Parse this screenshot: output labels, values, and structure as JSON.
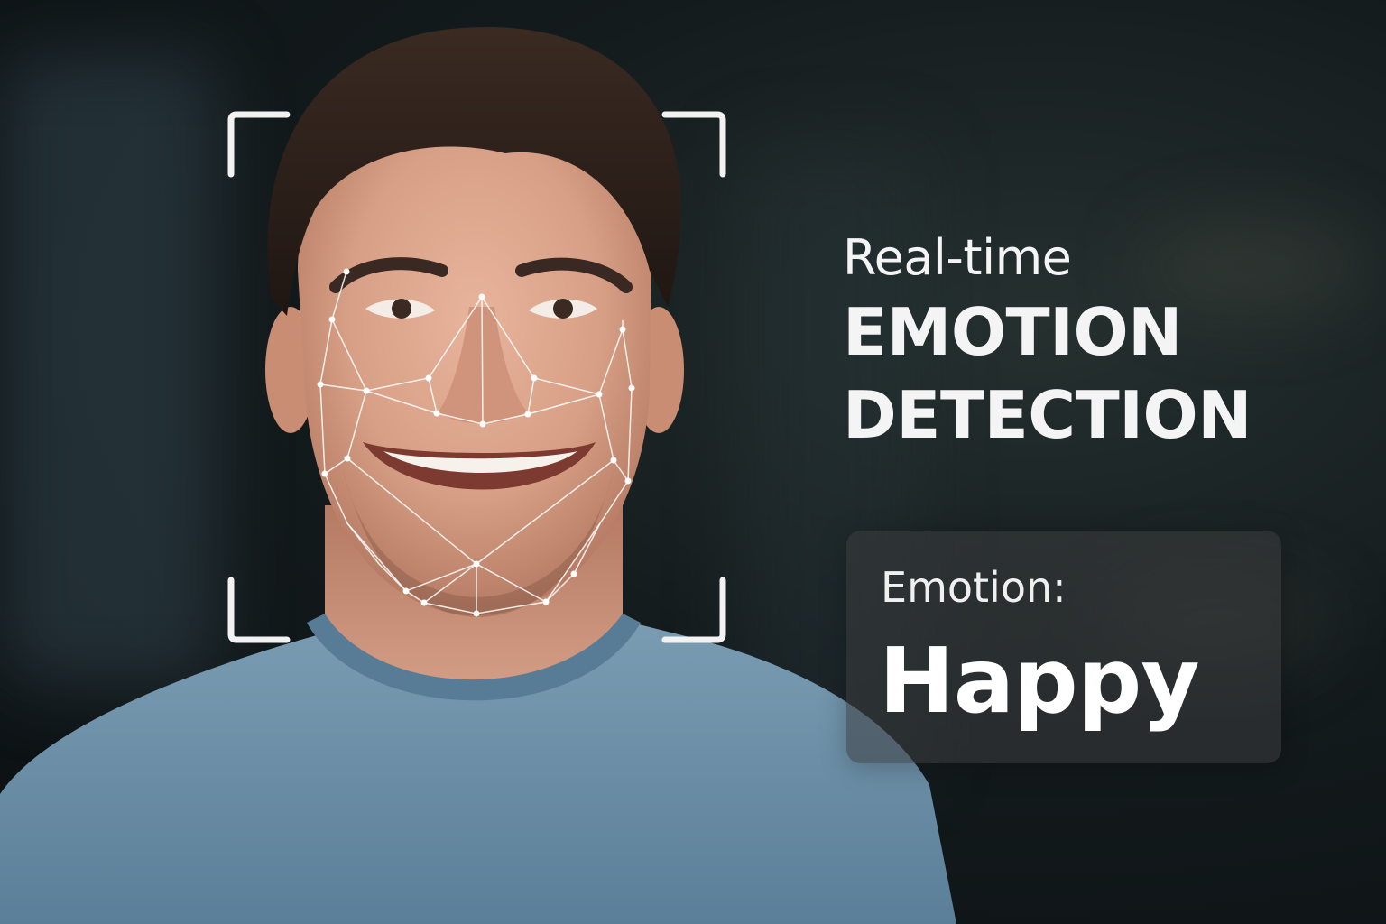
{
  "headline": {
    "line1": "Real-time",
    "line2": "EMOTION",
    "line3": "DETECTION"
  },
  "emotion_card": {
    "label": "Emotion:",
    "value": "Happy"
  },
  "colors": {
    "background": "#141b1d",
    "shirt": "#6a8fa8",
    "text": "#f4f4f4",
    "card": "#3a3c3e"
  },
  "icons": [
    "face-frame-icon",
    "face-mesh-icon"
  ]
}
